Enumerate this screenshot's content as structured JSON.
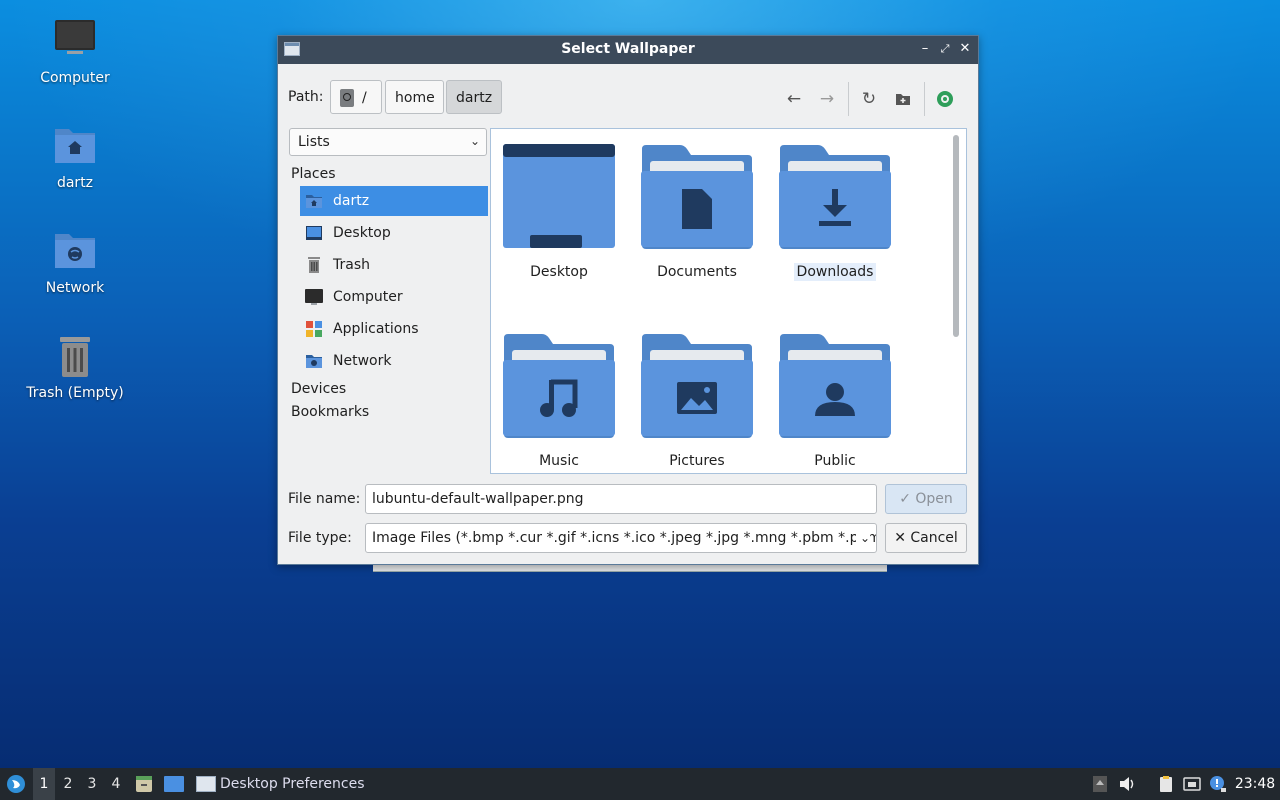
{
  "desktop": {
    "icons": [
      {
        "label": "Computer"
      },
      {
        "label": "dartz"
      },
      {
        "label": "Network"
      },
      {
        "label": "Trash (Empty)"
      }
    ]
  },
  "dialog": {
    "title": "Select Wallpaper",
    "path_label": "Path:",
    "breadcrumbs": [
      "/",
      "home",
      "dartz"
    ],
    "sidebar": {
      "view_select": "Lists",
      "places_heading": "Places",
      "places": [
        {
          "label": "dartz",
          "icon": "home-folder-icon"
        },
        {
          "label": "Desktop",
          "icon": "desktop-icon"
        },
        {
          "label": "Trash",
          "icon": "trash-icon"
        },
        {
          "label": "Computer",
          "icon": "computer-icon"
        },
        {
          "label": "Applications",
          "icon": "applications-icon"
        },
        {
          "label": "Network",
          "icon": "network-icon"
        }
      ],
      "devices_heading": "Devices",
      "bookmarks_heading": "Bookmarks"
    },
    "files": [
      {
        "name": "Desktop"
      },
      {
        "name": "Documents"
      },
      {
        "name": "Downloads"
      },
      {
        "name": "Music"
      },
      {
        "name": "Pictures"
      },
      {
        "name": "Public"
      }
    ],
    "file_name_label": "File name:",
    "file_name_value": "lubuntu-default-wallpaper.png",
    "file_type_label": "File type:",
    "file_type_value": "Image Files (*.bmp *.cur *.gif *.icns *.ico *.jpeg *.jpg *.mng *.pbm *.pgm",
    "open_label": "Open",
    "cancel_label": "Cancel"
  },
  "taskbar": {
    "workspaces": [
      "1",
      "2",
      "3",
      "4"
    ],
    "active_workspace": "1",
    "task_label": "Desktop Preferences",
    "clock": "23:48"
  },
  "colors": {
    "accent": "#3d8ee4",
    "folder": "#5b94dd",
    "folder_dark": "#1f3a5f",
    "titlebar": "#3c4a5a",
    "taskbar": "#22282e"
  }
}
